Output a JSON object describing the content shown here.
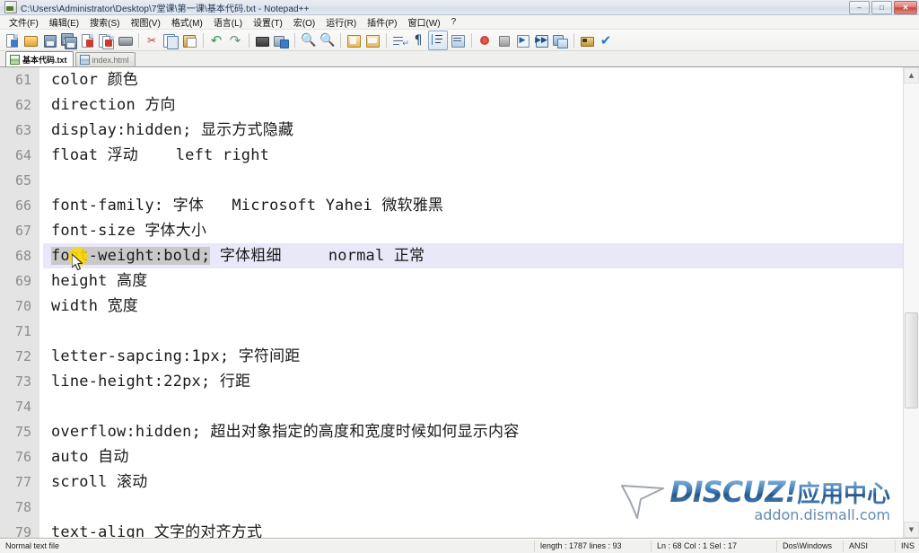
{
  "window": {
    "title": "C:\\Users\\Administrator\\Desktop\\7堂课\\第一课\\基本代码.txt - Notepad++",
    "minimize_label": "–",
    "maximize_label": "□",
    "close_label": "✕",
    "icon_name": "notepadpp-document-icon"
  },
  "menu": {
    "items": [
      {
        "label": "文件(F)"
      },
      {
        "label": "编辑(E)"
      },
      {
        "label": "搜索(S)"
      },
      {
        "label": "视图(V)"
      },
      {
        "label": "格式(M)"
      },
      {
        "label": "语言(L)"
      },
      {
        "label": "设置(T)"
      },
      {
        "label": "宏(O)"
      },
      {
        "label": "运行(R)"
      },
      {
        "label": "插件(P)"
      },
      {
        "label": "窗口(W)"
      },
      {
        "label": "?"
      }
    ]
  },
  "toolbar": {
    "buttons": [
      {
        "name": "new-file-icon"
      },
      {
        "name": "open-file-icon"
      },
      {
        "name": "save-icon"
      },
      {
        "name": "save-all-icon"
      },
      {
        "name": "close-file-icon"
      },
      {
        "name": "close-all-files-icon"
      },
      {
        "name": "print-icon"
      },
      {
        "name": "cut-icon"
      },
      {
        "name": "copy-icon"
      },
      {
        "name": "paste-icon"
      },
      {
        "name": "undo-icon"
      },
      {
        "name": "redo-icon"
      },
      {
        "name": "find-icon"
      },
      {
        "name": "replace-icon"
      },
      {
        "name": "zoom-in-icon"
      },
      {
        "name": "zoom-out-icon"
      },
      {
        "name": "sync-vertical-scroll-icon"
      },
      {
        "name": "sync-horizontal-scroll-icon"
      },
      {
        "name": "word-wrap-icon"
      },
      {
        "name": "show-all-characters-icon"
      },
      {
        "name": "indent-guideline-icon"
      },
      {
        "name": "user-defined-dialog-icon"
      },
      {
        "name": "record-macro-icon"
      },
      {
        "name": "stop-macro-icon"
      },
      {
        "name": "playback-macro-icon"
      },
      {
        "name": "run-macro-multiple-icon"
      },
      {
        "name": "save-macro-icon"
      },
      {
        "name": "run-icon"
      },
      {
        "name": "spell-check-icon"
      }
    ]
  },
  "tabs": [
    {
      "label": "基本代码.txt",
      "active": true
    },
    {
      "label": "index.html",
      "active": false
    }
  ],
  "editor": {
    "current_line": 68,
    "selection_text": "font-weight:bold;",
    "lines": [
      {
        "no": "61",
        "pre": "color 颜色",
        "sel": "",
        "post": ""
      },
      {
        "no": "62",
        "pre": "direction 方向",
        "sel": "",
        "post": ""
      },
      {
        "no": "63",
        "pre": "display:hidden; 显示方式隐藏",
        "sel": "",
        "post": ""
      },
      {
        "no": "64",
        "pre": "float 浮动    left right",
        "sel": "",
        "post": ""
      },
      {
        "no": "65",
        "pre": "",
        "sel": "",
        "post": ""
      },
      {
        "no": "66",
        "pre": "font-family: 字体   Microsoft Yahei 微软雅黑",
        "sel": "",
        "post": ""
      },
      {
        "no": "67",
        "pre": "font-size 字体大小",
        "sel": "",
        "post": ""
      },
      {
        "no": "68",
        "pre": "",
        "sel": "font-weight:bold;",
        "post": " 字体粗细     normal 正常",
        "current": true
      },
      {
        "no": "69",
        "pre": "height 高度",
        "sel": "",
        "post": ""
      },
      {
        "no": "70",
        "pre": "width 宽度",
        "sel": "",
        "post": ""
      },
      {
        "no": "71",
        "pre": "",
        "sel": "",
        "post": ""
      },
      {
        "no": "72",
        "pre": "letter-sapcing:1px; 字符间距",
        "sel": "",
        "post": ""
      },
      {
        "no": "73",
        "pre": "line-height:22px; 行距",
        "sel": "",
        "post": ""
      },
      {
        "no": "74",
        "pre": "",
        "sel": "",
        "post": ""
      },
      {
        "no": "75",
        "pre": "overflow:hidden; 超出对象指定的高度和宽度时候如何显示内容",
        "sel": "",
        "post": ""
      },
      {
        "no": "76",
        "pre": "auto 自动",
        "sel": "",
        "post": ""
      },
      {
        "no": "77",
        "pre": "scroll 滚动",
        "sel": "",
        "post": ""
      },
      {
        "no": "78",
        "pre": "",
        "sel": "",
        "post": ""
      },
      {
        "no": "79",
        "pre": "text-align 文字的对齐方式",
        "sel": "",
        "post": ""
      }
    ]
  },
  "watermark": {
    "brand": "DISCUZ",
    "bang": "!",
    "cn": "应用中心",
    "url": "addon.dismall.com",
    "arrow_icon": "mouse-pointer-icon"
  },
  "statusbar": {
    "doc_type": "Normal text file",
    "length_lines": "length : 1787   lines : 93",
    "caret_info": "Ln : 68   Col : 1   Sel : 17",
    "eol": "Dos\\Windows",
    "encoding": "ANSI",
    "insert_mode": "INS"
  },
  "colors": {
    "current_line": "#e8e8f8",
    "selection": "#c9c9c9",
    "gutter": "#e4e4e4",
    "accent": "#2f6fae",
    "click_halo": "#ffd800"
  }
}
